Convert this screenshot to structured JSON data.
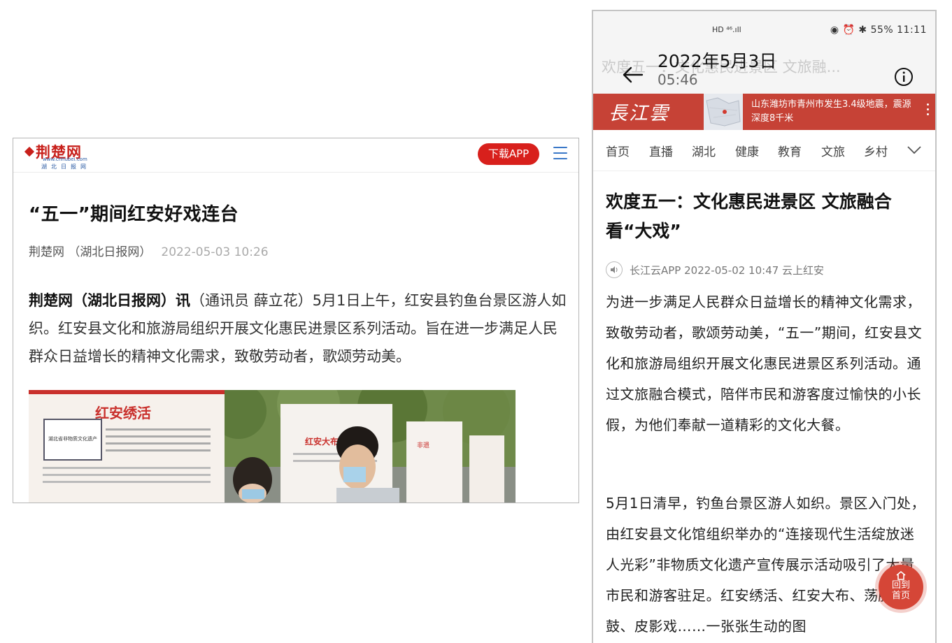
{
  "left": {
    "logo": {
      "main": "荆楚网",
      "url": "www.cnhubei.com",
      "sub": "湖北日报网"
    },
    "download_label": "下载APP",
    "title": "“五一”期间红安好戏连台",
    "source": "荆楚网 （湖北日报网）",
    "date": "2022-05-03 10:26",
    "body_lead": "荆楚网（湖北日报网）讯",
    "body_rest": "（通讯员 薛立花）5月1日上午，红安县钓鱼台景区游人如织。红安县文化和旅游局组织开展文化惠民进景区系列活动。旨在进一步满足人民群众日益增长的精神文化需求，致敬劳动者，歌颂劳动美。",
    "photo": {
      "board1_title": "红安绣活",
      "board1_caption": "湖北省非物质文化遗产",
      "board2_title": "红安大布",
      "board3_title": "非遗"
    }
  },
  "phone": {
    "status_left": "HD ⁴⁶.ıll",
    "status_right": "55%  11:11",
    "date": "2022年5月3日",
    "time": "05:46",
    "faded_title": "欢度五一：文化惠民进景区 文旅融...",
    "banner": {
      "logo": "長江雲",
      "headline": "山东潍坊市青州市发生3.4级地震，震源深度8千米"
    },
    "nav": [
      "首页",
      "直播",
      "湖北",
      "健康",
      "教育",
      "文旅",
      "乡村"
    ],
    "title": "欢度五一：文化惠民进景区 文旅融合看“大戏”",
    "meta": "长江云APP  2022-05-02 10:47  云上红安",
    "para1": "为进一步满足人民群众日益增长的精神文化需求，致敬劳动者，歌颂劳动美，“五一”期间，红安县文化和旅游局组织开展文化惠民进景区系列活动。通过文旅融合模式，陪伴市民和游客度过愉快的小长假，为他们奉献一道精彩的文化大餐。",
    "para2": "5月1日清早，钓鱼台景区游人如织。景区入门处，由红安县文化馆组织举办的“连接现代生活绽放迷人光彩”非物质文化遗产宣传展示活动吸引了大量市民和游客驻足。红安绣活、红安大布、荡腔锣鼓、皮影戏……一张张生动的图",
    "home_button": [
      "回到",
      "首页"
    ]
  }
}
